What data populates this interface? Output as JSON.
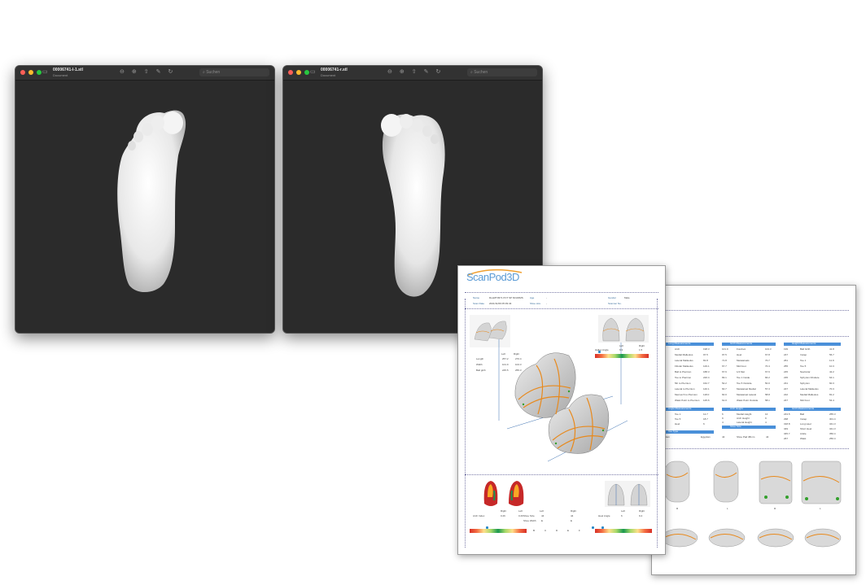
{
  "windows": [
    {
      "title": "00006741-l-1.stl",
      "subtitle": "Document",
      "search_placeholder": "Suchen"
    },
    {
      "title": "00006741-r.stl",
      "subtitle": "Document",
      "search_placeholder": "Suchen"
    }
  ],
  "icons": [
    "close-light",
    "minimize-light",
    "zoom-light",
    "sidebar-icon",
    "zoom-out-icon",
    "zoom-in-icon",
    "share-icon",
    "markup-icon",
    "rotate-icon",
    "search-icon"
  ],
  "colors": {
    "window_bg": "#2b2b2b",
    "titlebar_bg": "#323232",
    "brand_blue": "#5b9bd5",
    "table_header_blue": "#4a90d9",
    "contour_orange": "#e8891c"
  },
  "report_front": {
    "logo": "ScanPod3D",
    "fields": {
      "name_label": "Name",
      "name_value": "RuoMT4571 PCT SP 60130MS",
      "age_label": "Age",
      "age_value": "-",
      "gender_label": "Gender",
      "gender_value": "Male",
      "scan_date_label": "Scan Date",
      "scan_date_value": "2021/11/09 05:39:43",
      "shoe_size_label": "Shoe size",
      "shoe_size_value": "-",
      "scanner_label": "Scanner No.",
      "scanner_value": ""
    },
    "left_right": {
      "left": "Left",
      "right": "Right"
    },
    "meas_rows": [
      {
        "label": "Length",
        "left": "257.2",
        "right": "270.4"
      },
      {
        "label": "Width",
        "left": "101.9",
        "right": "104.3"
      },
      {
        "label": "Ball girth",
        "left": "245.5",
        "right": "255.3"
      }
    ],
    "hallux": {
      "label": "Hallux Angle",
      "left": "6.3",
      "right": "1.5"
    },
    "arch": {
      "label": "Arch Index",
      "left": "0.26",
      "right": "0.29"
    },
    "shoe_rows": [
      {
        "label": "Shoe Size",
        "left": "44",
        "right": "44"
      },
      {
        "label": "Shoe Width",
        "left": "E",
        "right": "E"
      }
    ],
    "scale_letters": [
      "B",
      "C",
      "D",
      "E",
      "F"
    ],
    "heel": {
      "label": "Heel Angle",
      "left": "6",
      "right": "9.4"
    }
  },
  "report_back": {
    "tables": [
      {
        "title": "Long Measurements",
        "rows": [
          [
            "SPM",
            "Arch",
            "198.3"
          ],
          [
            "SMT",
            "Medial Malleolus",
            "97.5"
          ],
          [
            "SAF",
            "Lateral Malleolus",
            "81.8"
          ],
          [
            "SPA",
            "Fibular Malleolus",
            "129.1"
          ],
          [
            "SPD",
            "Ball to Pternion",
            "188.3"
          ],
          [
            "SPB",
            "Toe to Pternion",
            "226.4"
          ],
          [
            "SPS",
            "5th to Pternion",
            "162.7"
          ],
          [
            "SFN",
            "Lateral to Pternion",
            "140.1"
          ],
          [
            "SPK",
            "Med arch to Pternion",
            "118.0"
          ],
          [
            "SPG",
            "Waist Point to Pternion",
            "125.6"
          ]
        ]
      },
      {
        "title": "Girth Measurements",
        "rows": [
          [
            "101.9",
            "Forefoot",
            "104.3"
          ],
          [
            "97.5",
            "Heel",
            "67.8"
          ],
          [
            "71.8",
            "Metatarsals",
            "70.7"
          ],
          [
            "67.7",
            "Mid Foot",
            "70.4"
          ],
          [
            "67.6",
            "1/4 Met",
            "67.6"
          ],
          [
            "83.1",
            "Toe 1 Inside",
            "84.2"
          ],
          [
            "52.2",
            "Toe 5 Outside",
            "50.0"
          ],
          [
            "60.7",
            "Metatarsal Medial",
            "57.3"
          ],
          [
            "60.0",
            "Metatarsal Lateral",
            "58.8"
          ],
          [
            "61.0",
            "Waist Point Outside",
            "58.1"
          ]
        ]
      },
      {
        "title": "Height Measurements",
        "rows": [
          [
            "199",
            "Ball Girth",
            "41.8"
          ],
          [
            "247",
            "Instep",
            "56.7"
          ],
          [
            "261",
            "Toe 1",
            "11.9"
          ],
          [
            "255",
            "Toe 5",
            "10.3"
          ],
          [
            "245",
            "Navicular",
            "42.2"
          ],
          [
            "235",
            "Sphyrion Fibulare",
            "64.1"
          ],
          [
            "231",
            "Sphyrion",
            "60.3"
          ],
          [
            "227",
            "Lateral Malleolus",
            "70.3"
          ],
          [
            "222",
            "Medial Malleolus",
            "81.2"
          ],
          [
            "247",
            "Mid Foot",
            "54.4"
          ]
        ]
      }
    ],
    "angle_title": "Angle Measurements",
    "angle_rows": [
      [
        "12.5",
        "Toe 1",
        "12.7"
      ],
      [
        "15.8",
        "Toe 5",
        "18.7"
      ],
      [
        "6",
        "Heel",
        "6"
      ]
    ],
    "toe_title": "Toe Type",
    "toe_row": [
      "Egyptian",
      "Egyptian"
    ],
    "arch_title": "Arch Height",
    "arch_rows": [
      [
        "6",
        "Medial Height",
        "10"
      ],
      [
        "9",
        "Arch Height",
        "9"
      ],
      [
        "4",
        "Lateral Height",
        "4"
      ]
    ],
    "shoe_title": "Shoe Size",
    "shoe_row": [
      "44",
      "Shoe Pad 38mm",
      "44"
    ],
    "girth_title": "Girth Measurements",
    "girth_rows": [
      [
        "243.5",
        "Ball",
        "255.3"
      ],
      [
        "298",
        "Instep",
        "301.4"
      ],
      [
        "318.8",
        "Long Heel",
        "341.3"
      ],
      [
        "349",
        "Short Heel",
        "341.3"
      ],
      [
        "345.7",
        "Ankle",
        "350.4"
      ],
      [
        "267",
        "Waist",
        "256.4"
      ]
    ],
    "view_labels": [
      "R",
      "L",
      "R",
      "L"
    ]
  }
}
